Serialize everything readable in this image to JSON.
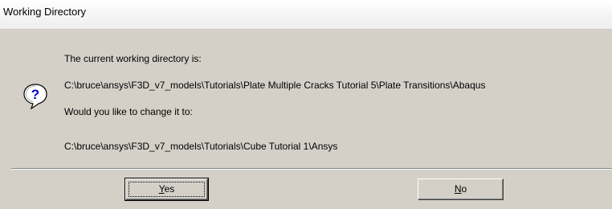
{
  "window": {
    "title": "Working Directory"
  },
  "message": {
    "line1": "The current working directory is:",
    "current_dir": "C:\\bruce\\ansys\\F3D_v7_models\\Tutorials\\Plate Multiple Cracks Tutorial 5\\Plate Transitions\\Abaqus",
    "line3": "Would you like to change it to:",
    "new_dir": "C:\\bruce\\ansys\\F3D_v7_models\\Tutorials\\Cube Tutorial 1\\Ansys",
    "icon": "question-icon"
  },
  "buttons": {
    "yes_accel": "Y",
    "yes_rest": "es",
    "no_accel": "N",
    "no_rest": "o"
  }
}
